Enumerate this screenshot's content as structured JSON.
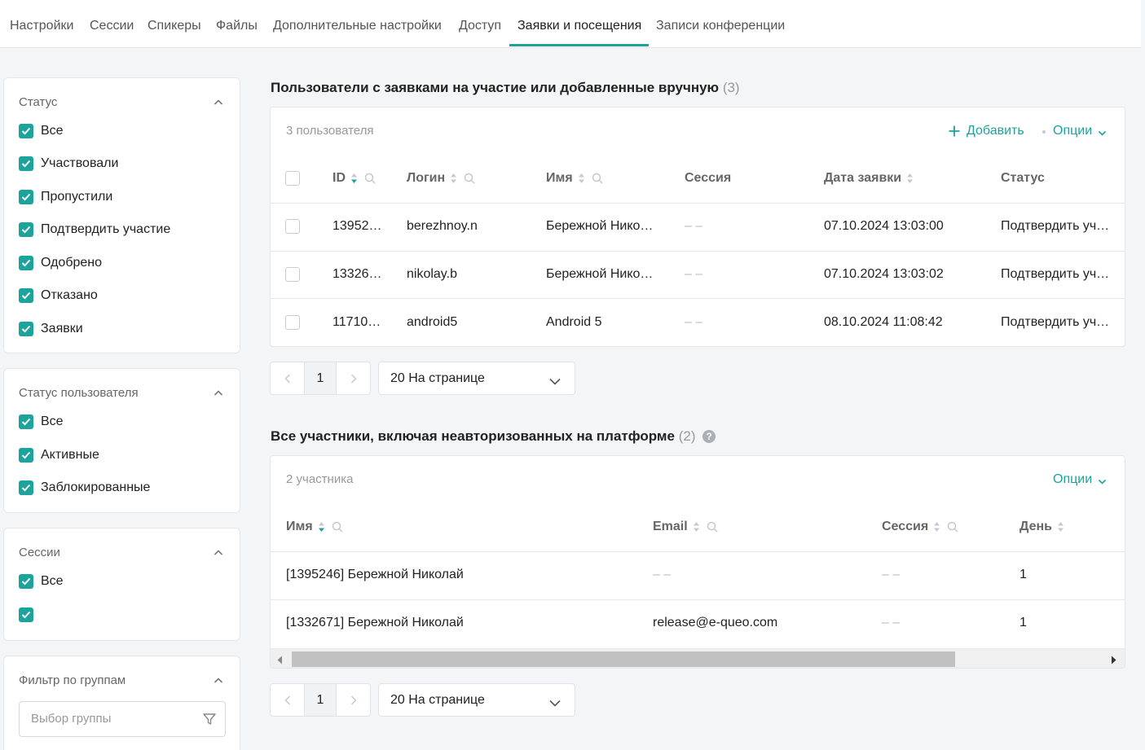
{
  "colors": {
    "accent": "#1ba39c",
    "text": "#222222",
    "muted": "#999999"
  },
  "tabs": [
    {
      "label": "Настройки",
      "active": false
    },
    {
      "label": "Сессии",
      "active": false
    },
    {
      "label": "Спикеры",
      "active": false
    },
    {
      "label": "Файлы",
      "active": false
    },
    {
      "label": "Дополнительные настройки",
      "active": false
    },
    {
      "label": "Доступ",
      "active": false
    },
    {
      "label": "Заявки и посещения",
      "active": true
    },
    {
      "label": "Записи конференции",
      "active": false
    }
  ],
  "filters": {
    "status": {
      "title": "Статус",
      "items": [
        "Все",
        "Участвовали",
        "Пропустили",
        "Подтвердить участие",
        "Одобрено",
        "Отказано",
        "Заявки"
      ]
    },
    "user_status": {
      "title": "Статус пользователя",
      "items": [
        "Все",
        "Активные",
        "Заблокированные"
      ]
    },
    "sessions": {
      "title": "Сессии",
      "items": [
        "Все",
        ""
      ]
    },
    "groups": {
      "title": "Фильтр по группам",
      "placeholder": "Выбор группы"
    }
  },
  "requests": {
    "title": "Пользователи с заявками на участие или добавленные вручную",
    "count": "(3)",
    "summary": "3 пользователя",
    "add_label": "Добавить",
    "options_label": "Опции",
    "columns": {
      "id": "ID",
      "login": "Логин",
      "name": "Имя",
      "session": "Сессия",
      "date": "Дата заявки",
      "status": "Статус"
    },
    "rows": [
      {
        "id": "13952…",
        "login": "berezhnoy.n",
        "name": "Бережной Нико…",
        "session": "– –",
        "date": "07.10.2024 13:03:00",
        "status": "Подтвердить уч…"
      },
      {
        "id": "13326…",
        "login": "nikolay.b",
        "name": "Бережной Нико…",
        "session": "– –",
        "date": "07.10.2024 13:03:02",
        "status": "Подтвердить уч…"
      },
      {
        "id": "11710…",
        "login": "android5",
        "name": "Android 5",
        "session": "– –",
        "date": "08.10.2024 11:08:42",
        "status": "Подтвердить уч…"
      }
    ],
    "pager": {
      "page": "1",
      "per_page": "20 На странице"
    }
  },
  "participants": {
    "title": "Все участники, включая неавторизованных на платформе",
    "count": "(2)",
    "help_icon": "?",
    "summary": "2 участника",
    "options_label": "Опции",
    "columns": {
      "name": "Имя",
      "email": "Email",
      "session": "Сессия",
      "day": "День"
    },
    "rows": [
      {
        "name": "[1395246] Бережной Николай",
        "email": "– –",
        "session": "– –",
        "day": "1"
      },
      {
        "name": "[1332671] Бережной Николай",
        "email": "release@e-queo.com",
        "session": "– –",
        "day": "1"
      }
    ],
    "pager": {
      "page": "1",
      "per_page": "20 На странице"
    }
  }
}
